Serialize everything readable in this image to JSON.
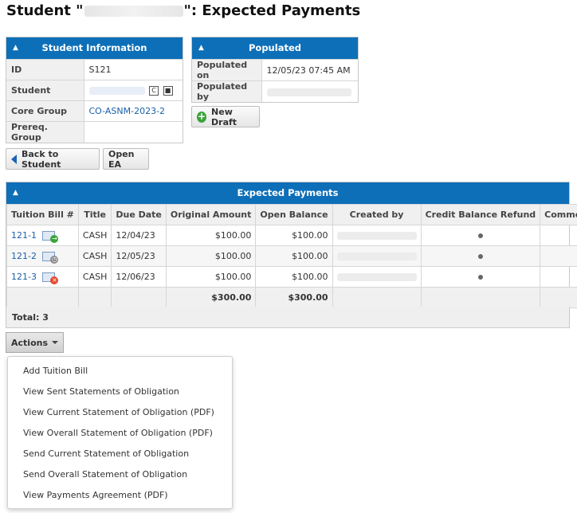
{
  "page": {
    "title_prefix": "Student \"",
    "title_suffix": "\": Expected Payments"
  },
  "student_info": {
    "header": "Student Information",
    "rows": [
      {
        "label": "ID",
        "value": "S121"
      },
      {
        "label": "Student",
        "value": ""
      },
      {
        "label": "Core Group",
        "value": "CO-ASNM-2023-2"
      },
      {
        "label": "Prereq. Group",
        "value": ""
      }
    ]
  },
  "populated": {
    "header": "Populated",
    "rows": [
      {
        "label": "Populated on",
        "value": "12/05/23 07:45 AM"
      },
      {
        "label": "Populated by",
        "value": ""
      }
    ]
  },
  "buttons": {
    "new_draft": "New Draft",
    "back_to_student": "Back to Student",
    "open_ea": "Open EA",
    "actions": "Actions"
  },
  "expected_payments": {
    "header": "Expected Payments",
    "columns": [
      "Tuition Bill #",
      "Title",
      "Due Date",
      "Original Amount",
      "Open Balance",
      "Created by",
      "Credit Balance Refund",
      "Comment"
    ],
    "rows": [
      {
        "bill": "121-1",
        "title": "CASH",
        "due": "12/04/23",
        "original": "$100.00",
        "balance": "$100.00",
        "status_icon": "sent-mail-icon"
      },
      {
        "bill": "121-2",
        "title": "CASH",
        "due": "12/05/23",
        "original": "$100.00",
        "balance": "$100.00",
        "status_icon": "pending-clock-icon"
      },
      {
        "bill": "121-3",
        "title": "CASH",
        "due": "12/06/23",
        "original": "$100.00",
        "balance": "$100.00",
        "status_icon": "failed-x-icon"
      }
    ],
    "totals": {
      "original": "$300.00",
      "balance": "$300.00"
    },
    "total_count": "Total: 3"
  },
  "actions_menu": {
    "items": [
      "Add Tuition Bill",
      "View Sent Statements of Obligation",
      "View Current Statement of Obligation (PDF)",
      "View Overall Statement of Obligation (PDF)",
      "Send Current Statement of Obligation",
      "Send Overall Statement of Obligation",
      "View Payments Agreement (PDF)"
    ]
  },
  "colors": {
    "header_blue": "#0d6fb8",
    "link_blue": "#1a5fa8",
    "label_bg": "#f0f0f0"
  }
}
